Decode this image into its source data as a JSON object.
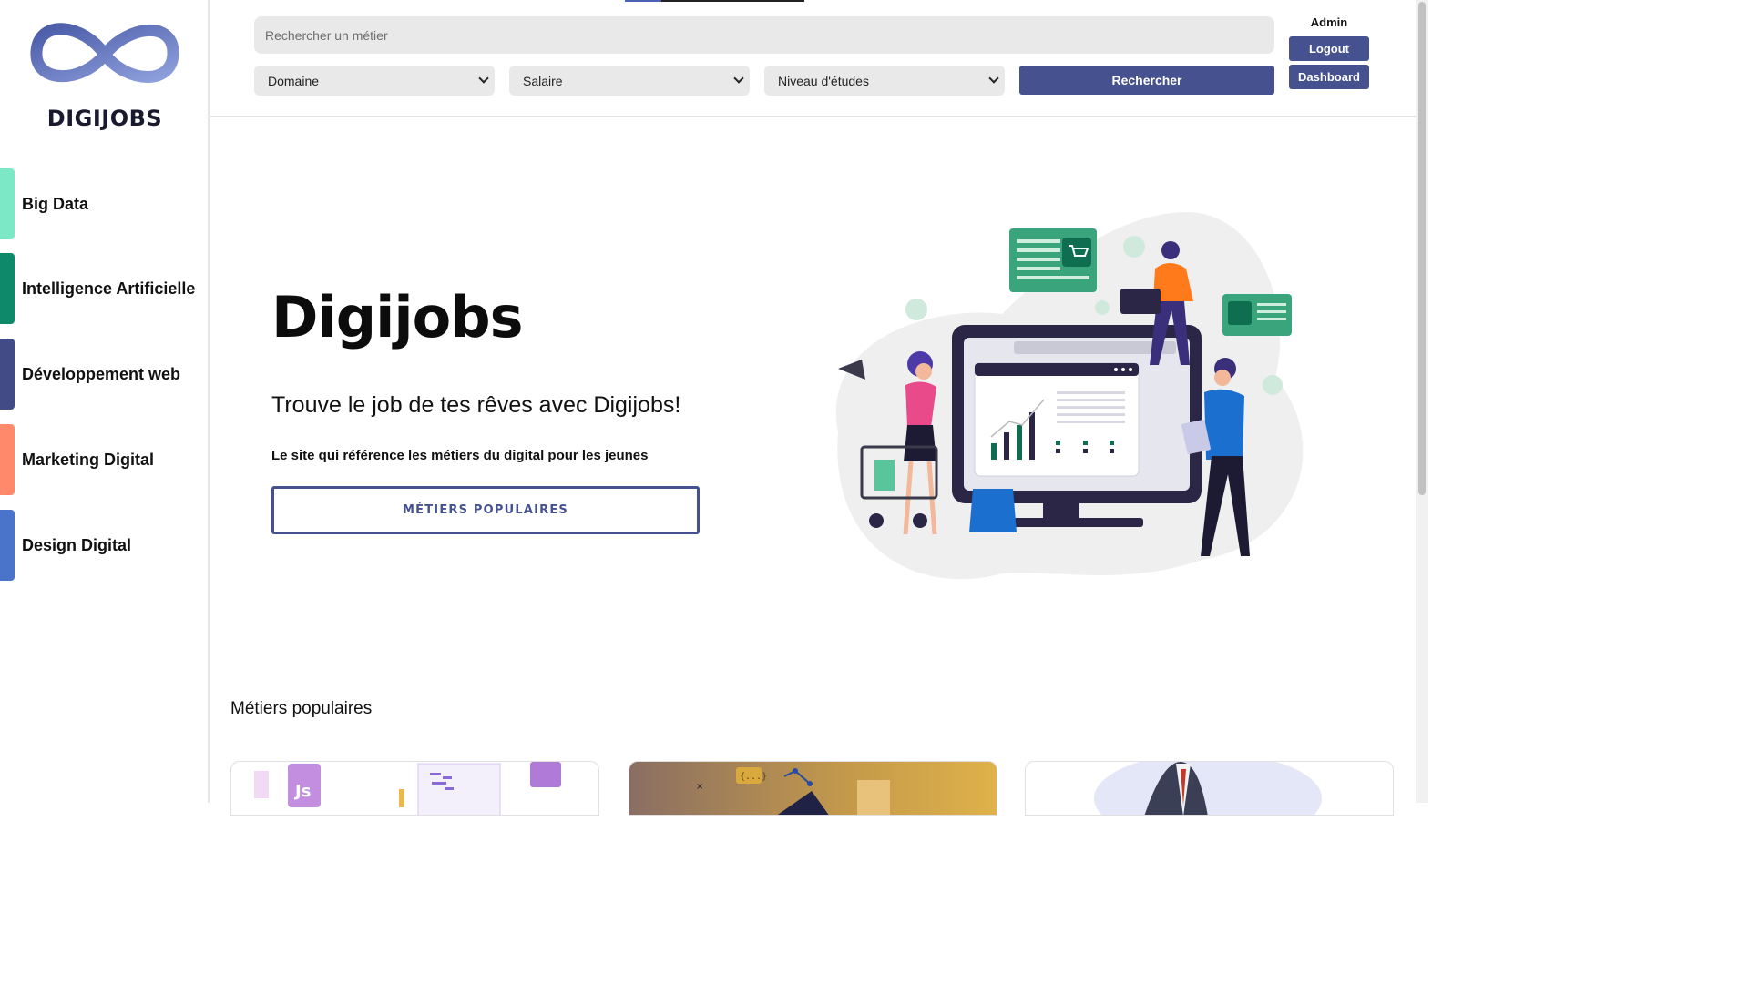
{
  "brand": {
    "name": "DIGIJOBS"
  },
  "sidebar": {
    "items": [
      {
        "label": "Big Data",
        "color": "#7de8c6"
      },
      {
        "label": "Intelligence Artificielle",
        "color": "#0e8a6b"
      },
      {
        "label": "Développement web",
        "color": "#434b86"
      },
      {
        "label": "Marketing Digital",
        "color": "#ff8a6b"
      },
      {
        "label": "Design Digital",
        "color": "#4a74c9"
      }
    ]
  },
  "header": {
    "search_placeholder": "Rechercher un métier",
    "filters": {
      "domaine": "Domaine",
      "salaire": "Salaire",
      "niveau": "Niveau d'études"
    },
    "search_button": "Rechercher",
    "user": "Admin",
    "logout": "Logout",
    "dashboard": "Dashboard"
  },
  "hero": {
    "title": "Digijobs",
    "subtitle": "Trouve le job de tes rêves avec Digijobs!",
    "description": "Le site qui référence les métiers du digital pour les jeunes",
    "button": "MÉTIERS POPULAIRES"
  },
  "popular": {
    "title": "Métiers populaires"
  },
  "colors": {
    "accent": "#465190",
    "input_bg": "#e9e9e9"
  }
}
